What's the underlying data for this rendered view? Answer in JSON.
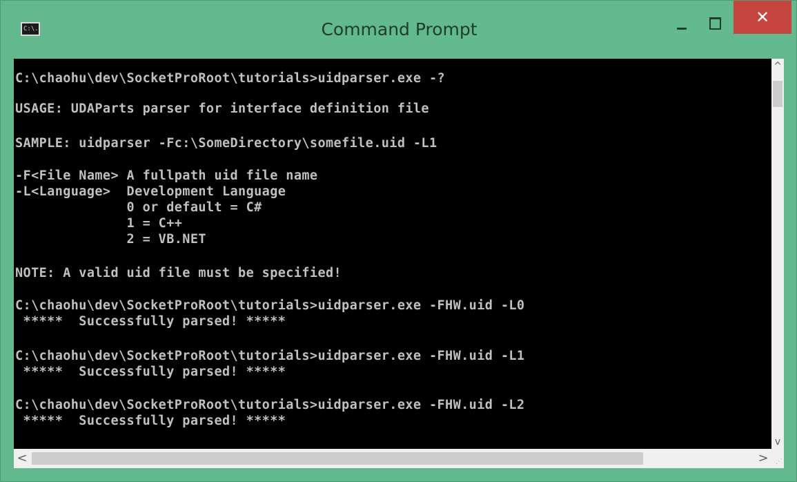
{
  "window": {
    "title": "Command Prompt",
    "icon": "cmd-icon",
    "icon_label": "C:\\.",
    "close_glyph": "✕"
  },
  "console": {
    "lines": [
      "C:\\chaohu\\dev\\SocketProRoot\\tutorials>uidparser.exe -?",
      "USAGE: UDAParts parser for interface definition file",
      "SAMPLE: uidparser -Fc:\\SomeDirectory\\somefile.uid -L1",
      "-F<File Name> A fullpath uid file name",
      "-L<Language>  Development Language",
      "              0 or default = C#",
      "              1 = C++",
      "              2 = VB.NET",
      "NOTE: A valid uid file must be specified!",
      "C:\\chaohu\\dev\\SocketProRoot\\tutorials>uidparser.exe -FHW.uid -L0",
      " *****  Successfully parsed! *****",
      "C:\\chaohu\\dev\\SocketProRoot\\tutorials>uidparser.exe -FHW.uid -L1",
      " *****  Successfully parsed! *****",
      "C:\\chaohu\\dev\\SocketProRoot\\tutorials>uidparser.exe -FHW.uid -L2",
      " *****  Successfully parsed! *****"
    ]
  },
  "scrollbars": {
    "up": "^",
    "down": "v",
    "left": "<",
    "right": ">"
  },
  "colors": {
    "frame": "#63b98e",
    "close": "#c7453f",
    "console_bg": "#000000",
    "console_text": "#c0c0c0"
  }
}
